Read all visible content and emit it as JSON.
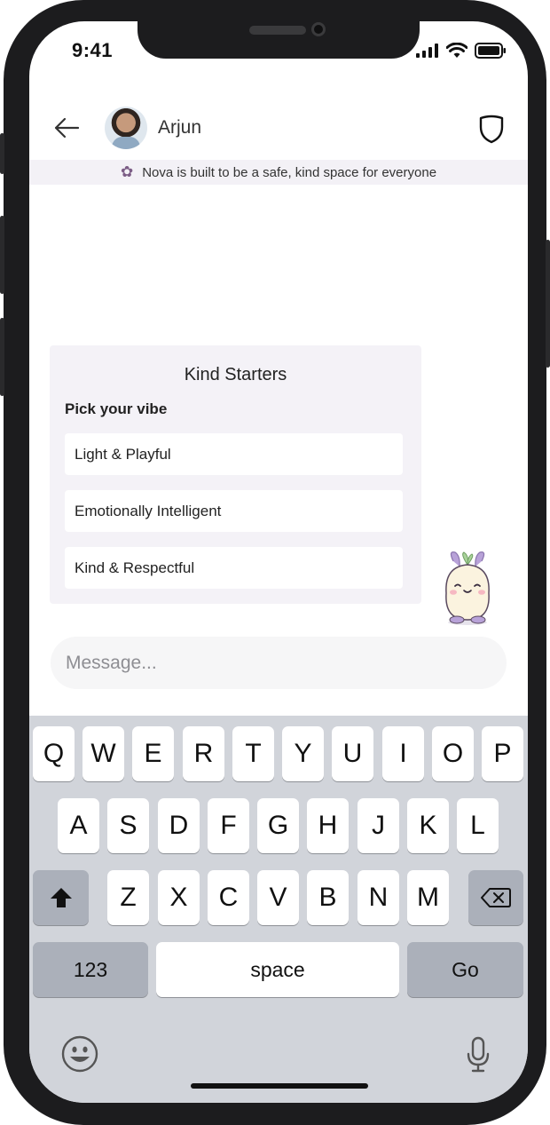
{
  "status_bar": {
    "time": "9:41"
  },
  "header": {
    "contact_name": "Arjun"
  },
  "safety_banner": {
    "text": "Nova is built to be a safe, kind space for everyone"
  },
  "kind_starters": {
    "title": "Kind Starters",
    "subtitle": "Pick your vibe",
    "options": [
      "Light & Playful",
      "Emotionally Intelligent",
      "Kind & Respectful"
    ]
  },
  "message_input": {
    "placeholder": "Message..."
  },
  "keyboard": {
    "row1": [
      "Q",
      "W",
      "E",
      "R",
      "T",
      "Y",
      "U",
      "I",
      "O",
      "P"
    ],
    "row2": [
      "A",
      "S",
      "D",
      "F",
      "G",
      "H",
      "J",
      "K",
      "L"
    ],
    "row3": [
      "Z",
      "X",
      "C",
      "V",
      "B",
      "N",
      "M"
    ],
    "numbers_label": "123",
    "space_label": "space",
    "go_label": "Go"
  },
  "icons": {
    "back": "arrow-left-icon",
    "shield": "shield-icon",
    "flower": "flower-icon",
    "shift": "shift-icon",
    "delete": "backspace-icon",
    "emoji": "emoji-icon",
    "mic": "microphone-icon"
  },
  "colors": {
    "accent": "#7c5d86",
    "banner_bg": "#f3f1f6",
    "card_bg": "#f4f2f7",
    "keyboard_bg": "#d1d4da"
  }
}
